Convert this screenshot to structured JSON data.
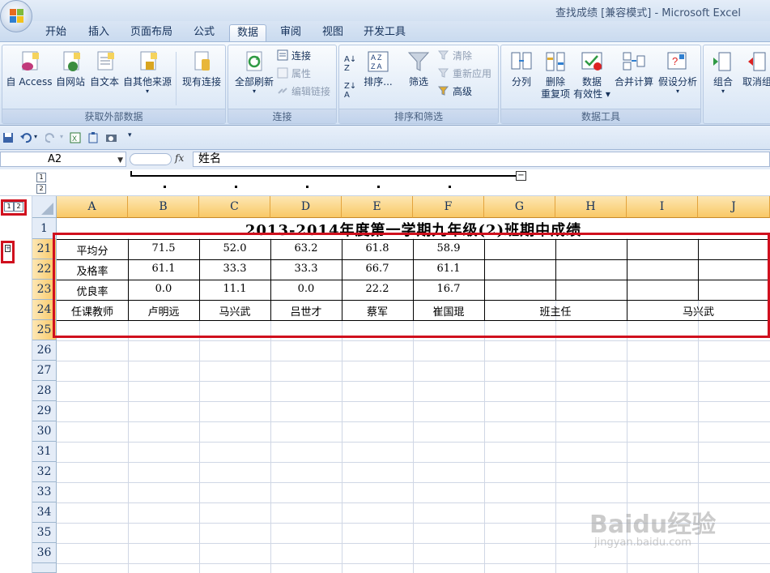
{
  "window": {
    "title": "查找成绩  [兼容模式] - Microsoft Excel"
  },
  "tabs": [
    "开始",
    "插入",
    "页面布局",
    "公式",
    "数据",
    "审阅",
    "视图",
    "开发工具"
  ],
  "active_tab": "数据",
  "ribbon": {
    "groups": {
      "external": "获取外部数据",
      "connections": "连接",
      "sort_filter": "排序和筛选",
      "data_tools": "数据工具"
    },
    "buttons": {
      "access": "自 Access",
      "web": "自网站",
      "text": "自文本",
      "other": "自其他来源",
      "existing": "现有连接",
      "refresh_all": "全部刷新",
      "connections": "连接",
      "properties": "属性",
      "edit_links": "编辑链接",
      "sort": "排序...",
      "filter": "筛选",
      "clear": "清除",
      "reapply": "重新应用",
      "advanced": "高级",
      "text_to_columns": "分列",
      "remove_dup_1": "删除",
      "remove_dup_2": "重复项",
      "validation_1": "数据",
      "validation_2": "有效性",
      "consolidate": "合并计算",
      "what_if": "假设分析",
      "group": "组合",
      "ungroup": "取消组合"
    }
  },
  "formula_bar": {
    "name_box": "A2",
    "fx": "fx",
    "formula": "姓名"
  },
  "outline": {
    "levels": [
      "1",
      "2"
    ],
    "collapse": "−"
  },
  "columns": [
    "A",
    "B",
    "C",
    "D",
    "E",
    "F",
    "G",
    "H",
    "I",
    "J"
  ],
  "rows": [
    "1",
    "21",
    "22",
    "23",
    "24",
    "25",
    "26",
    "27",
    "28",
    "29",
    "30",
    "31",
    "32",
    "33",
    "34",
    "35",
    "36"
  ],
  "sheet": {
    "title": "2013-2014年度第一学期九年级(2)班期中成绩",
    "data_rows": [
      {
        "label": "平均分",
        "values": [
          "71.5",
          "52.0",
          "63.2",
          "61.8",
          "58.9"
        ]
      },
      {
        "label": "及格率",
        "values": [
          "61.1",
          "33.3",
          "33.3",
          "66.7",
          "61.1"
        ]
      },
      {
        "label": "优良率",
        "values": [
          "0.0",
          "11.1",
          "0.0",
          "22.2",
          "16.7"
        ]
      }
    ],
    "teacher_row": {
      "label": "任课教师",
      "teachers": [
        "卢明远",
        "马兴武",
        "吕世才",
        "蔡军",
        "崔国琨"
      ],
      "head_label": "班主任",
      "head_name": "马兴武"
    }
  },
  "watermark": {
    "main": "Baidu经验",
    "sub": "jingyan.baidu.com"
  }
}
